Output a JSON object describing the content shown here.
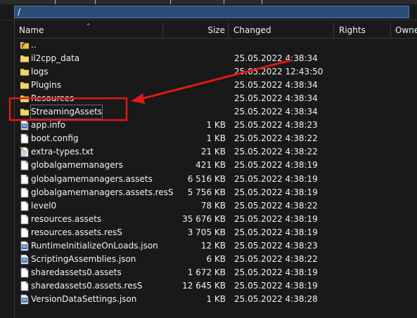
{
  "path": {
    "value": "/"
  },
  "columns": {
    "name": "Name",
    "size": "Size",
    "changed": "Changed",
    "rights": "Rights",
    "owner": "Owne"
  },
  "files": [
    {
      "name": "..",
      "size": "",
      "changed": "",
      "icon": "parent-dir-icon"
    },
    {
      "name": "il2cpp_data",
      "size": "",
      "changed": "25.05.2022 4:38:34",
      "icon": "folder-icon"
    },
    {
      "name": "logs",
      "size": "",
      "changed": "25.05.2022 12:43:50",
      "icon": "folder-icon"
    },
    {
      "name": "Plugins",
      "size": "",
      "changed": "25.05.2022 4:38:34",
      "icon": "folder-icon"
    },
    {
      "name": "Resources",
      "size": "",
      "changed": "25.05.2022 4:38:34",
      "icon": "folder-icon"
    },
    {
      "name": "StreamingAssets",
      "size": "",
      "changed": "25.05.2022 4:38:34",
      "icon": "folder-icon"
    },
    {
      "name": "app.info",
      "size": "1 KB",
      "changed": "25.05.2022 4:38:23",
      "icon": "info-file-icon"
    },
    {
      "name": "boot.config",
      "size": "1 KB",
      "changed": "25.05.2022 4:38:22",
      "icon": "file-icon"
    },
    {
      "name": "extra-types.txt",
      "size": "21 KB",
      "changed": "25.05.2022 4:38:22",
      "icon": "text-file-icon"
    },
    {
      "name": "globalgamemanagers",
      "size": "421 KB",
      "changed": "25.05.2022 4:38:19",
      "icon": "file-icon"
    },
    {
      "name": "globalgamemanagers.assets",
      "size": "6 516 KB",
      "changed": "25.05.2022 4:38:19",
      "icon": "file-icon"
    },
    {
      "name": "globalgamemanagers.assets.resS",
      "size": "5 756 KB",
      "changed": "25.05.2022 4:38:19",
      "icon": "file-icon"
    },
    {
      "name": "level0",
      "size": "78 KB",
      "changed": "25.05.2022 4:38:22",
      "icon": "file-icon"
    },
    {
      "name": "resources.assets",
      "size": "35 676 KB",
      "changed": "25.05.2022 4:38:19",
      "icon": "file-icon"
    },
    {
      "name": "resources.assets.resS",
      "size": "3 705 KB",
      "changed": "25.05.2022 4:38:19",
      "icon": "file-icon"
    },
    {
      "name": "RuntimeInitializeOnLoads.json",
      "size": "12 KB",
      "changed": "25.05.2022 4:38:23",
      "icon": "json-file-icon"
    },
    {
      "name": "ScriptingAssemblies.json",
      "size": "6 KB",
      "changed": "25.05.2022 4:38:22",
      "icon": "json-file-icon"
    },
    {
      "name": "sharedassets0.assets",
      "size": "1 672 KB",
      "changed": "25.05.2022 4:38:19",
      "icon": "file-icon"
    },
    {
      "name": "sharedassets0.assets.resS",
      "size": "12 645 KB",
      "changed": "25.05.2022 4:38:19",
      "icon": "file-icon"
    },
    {
      "name": "VersionDataSettings.json",
      "size": "1 KB",
      "changed": "25.05.2022 4:38:28",
      "icon": "json-file-icon"
    }
  ],
  "annotation": {
    "color": "#e01818",
    "highlighted": "StreamingAssets"
  },
  "colors": {
    "background": "#191919",
    "path_bar": "#2c4d76",
    "folder": "#e8c34a"
  }
}
